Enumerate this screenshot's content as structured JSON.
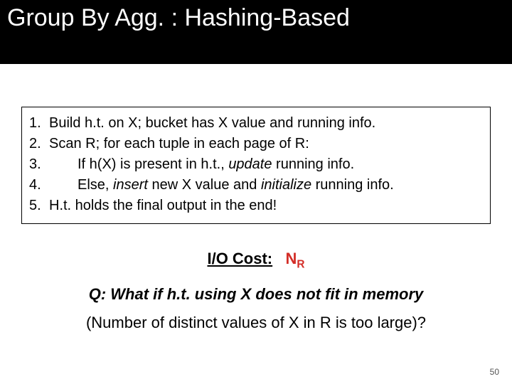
{
  "title": "Group By Agg. : Hashing-Based",
  "steps": [
    {
      "num": "1.",
      "text": "Build h.t. on X; bucket has X value and running info.",
      "indent": false
    },
    {
      "num": "2.",
      "text": "Scan R; for each tuple in each page of R:",
      "indent": false
    },
    {
      "num": "3.",
      "prefix": "If h(X) is present in h.t., ",
      "em1": "update",
      "suffix": " running info.",
      "indent": true
    },
    {
      "num": "4.",
      "prefix": "Else, ",
      "em1": "insert",
      "mid": " new X value and ",
      "em2": "initialize",
      "suffix": " running info.",
      "indent": true
    },
    {
      "num": "5.",
      "text": "H.t. holds the final output in the end!",
      "indent": false
    }
  ],
  "io_label": "I/O Cost:",
  "io_value_base": "N",
  "io_value_sub": "R",
  "question_line": "Q: What if h.t. using X does not fit in memory",
  "question_sub": "(Number of distinct values of X in R is too large)?",
  "page_number": "50"
}
